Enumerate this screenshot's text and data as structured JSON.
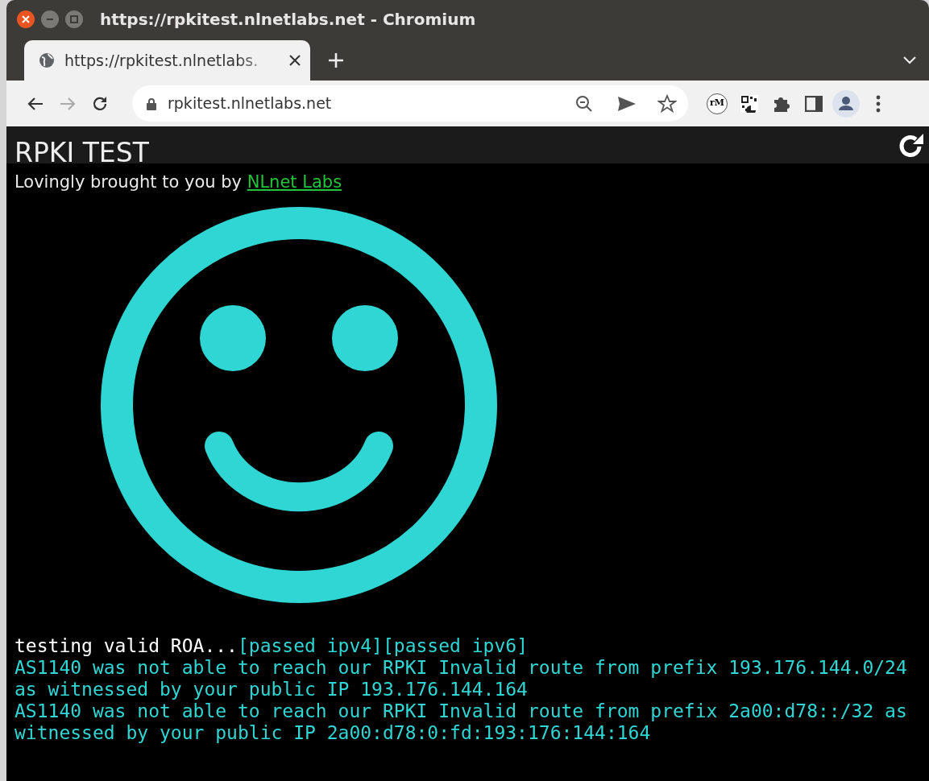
{
  "window": {
    "title": "https://rpkitest.nlnetlabs.net - Chromium"
  },
  "tabs": [
    {
      "label": "https://rpkitest.nlnetlabs.",
      "selected": true
    }
  ],
  "address_bar": {
    "url": "rpkitest.nlnetlabs.net"
  },
  "extensions": [
    {
      "kind": "badge",
      "label": "rM"
    },
    {
      "kind": "qr"
    }
  ],
  "page": {
    "title": "RPKI TEST",
    "byline": "Lovingly brought to you by",
    "byline_link": "NLnet Labs",
    "test": {
      "label": "testing valid ROA...",
      "results": [
        "[passed ipv4]",
        "[passed ipv6]"
      ]
    },
    "messages": [
      "AS1140 was not able to reach our RPKI Invalid route from prefix 193.176.144.0/24 as witnessed by your public IP 193.176.144.164",
      "AS1140 was not able to reach our RPKI Invalid route from prefix 2a00:d78::/32 as witnessed by your public IP 2a00:d78:0:fd:193:176:144:164"
    ]
  }
}
